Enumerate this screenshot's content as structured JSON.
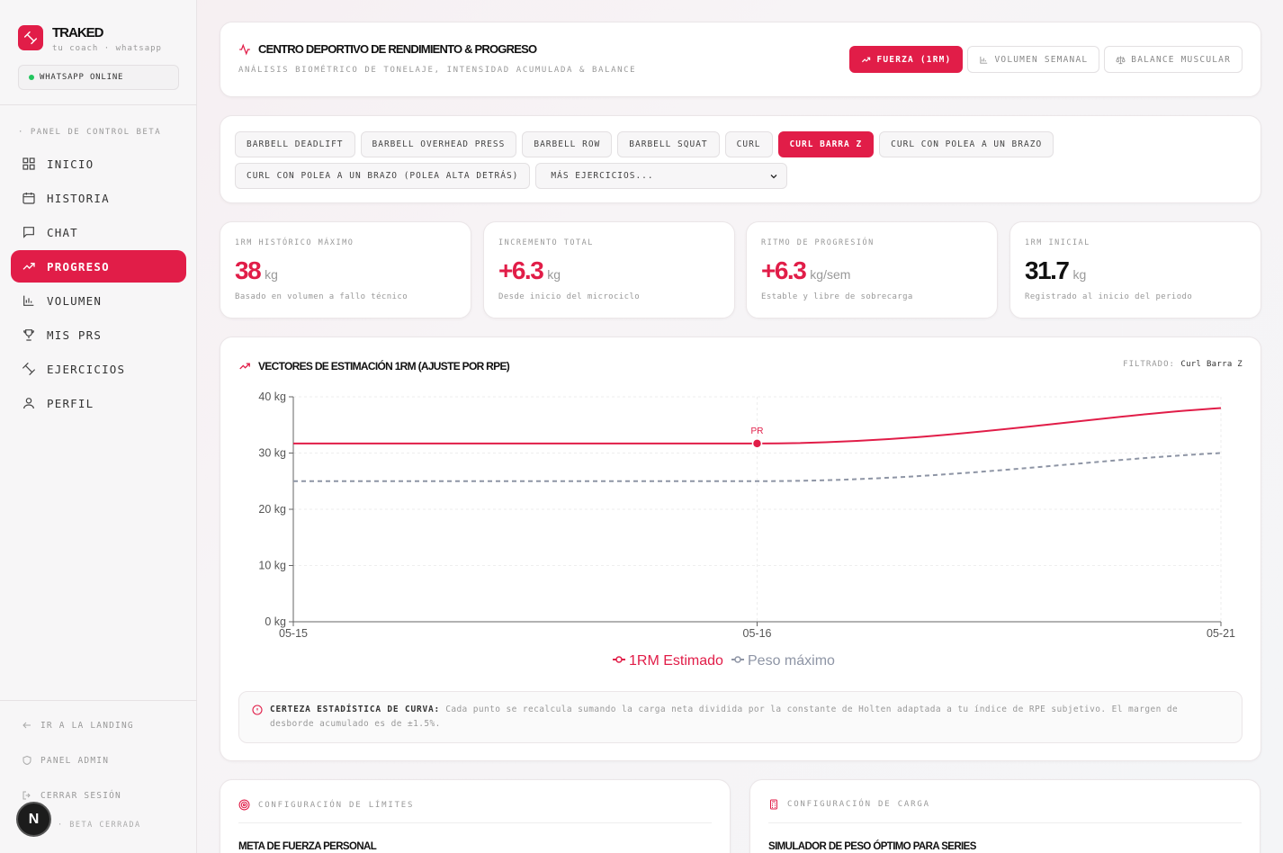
{
  "brand": {
    "name": "TRAKED",
    "subtitle": "tu coach · whatsapp"
  },
  "whatsapp_status": "WHATSAPP ONLINE",
  "sidebar": {
    "section_label": "· PANEL DE CONTROL BETA",
    "items": [
      {
        "label": "INICIO",
        "icon": "grid-icon"
      },
      {
        "label": "HISTORIA",
        "icon": "calendar-icon"
      },
      {
        "label": "CHAT",
        "icon": "chat-icon"
      },
      {
        "label": "PROGRESO",
        "icon": "trending-up-icon",
        "active": true
      },
      {
        "label": "VOLUMEN",
        "icon": "bar-chart-icon"
      },
      {
        "label": "MIS PRS",
        "icon": "trophy-icon"
      },
      {
        "label": "EJERCICIOS",
        "icon": "dumbbell-icon"
      },
      {
        "label": "PERFIL",
        "icon": "user-icon"
      }
    ],
    "footer": {
      "landing": "IR A LA LANDING",
      "admin": "PANEL ADMIN",
      "logout": "CERRAR SESIÓN",
      "beta": "· BETA CERRADA"
    },
    "badge": "N"
  },
  "header": {
    "title": "CENTRO DEPORTIVO DE RENDIMIENTO & PROGRESO",
    "subtitle": "ANÁLISIS BIOMÉTRICO DE TONELAJE, INTENSIDAD ACUMULADA & BALANCE",
    "tabs": [
      {
        "label": "FUERZA (1RM)",
        "active": true
      },
      {
        "label": "VOLUMEN SEMANAL"
      },
      {
        "label": "BALANCE MUSCULAR"
      }
    ]
  },
  "exercises": {
    "row1": [
      "BARBELL DEADLIFT",
      "BARBELL OVERHEAD PRESS",
      "BARBELL ROW",
      "BARBELL SQUAT",
      "CURL",
      "CURL BARRA Z",
      "CURL CON POLEA A UN BRAZO"
    ],
    "active": "CURL BARRA Z",
    "row2": [
      "CURL CON POLEA A UN BRAZO (POLEA ALTA DETRÁS)"
    ],
    "more_select": "MÁS EJERCICIOS..."
  },
  "stats": [
    {
      "label": "1RM HISTÓRICO MÁXIMO",
      "value": "38",
      "unit": "kg",
      "desc": "Basado en volumen a fallo técnico",
      "color": "#e11d48"
    },
    {
      "label": "INCREMENTO TOTAL",
      "value": "+6.3",
      "unit": "kg",
      "desc": "Desde inicio del microciclo",
      "color": "#e11d48"
    },
    {
      "label": "RITMO DE PROGRESIÓN",
      "value": "+6.3",
      "unit": "kg/sem",
      "desc": "Estable y libre de sobrecarga",
      "color": "#e11d48"
    },
    {
      "label": "1RM INICIAL",
      "value": "31.7",
      "unit": "kg",
      "desc": "Registrado al inicio del periodo",
      "color": "#111111"
    }
  ],
  "chart": {
    "title": "VECTORES DE ESTIMACIÓN 1RM (AJUSTE POR RPE)",
    "filter_label": "FILTRADO:",
    "filter_value": "Curl Barra Z",
    "info_title": "CERTEZA ESTADÍSTICA DE CURVA:",
    "info_text": "Cada punto se recalcula sumando la carga neta dividida por la constante de Holten adaptada a tu índice de RPE subjetivo. El margen de desborde acumulado es de ±1.5%."
  },
  "chart_data": {
    "type": "line",
    "x": [
      "05-15",
      "05-16",
      "05-21"
    ],
    "series": [
      {
        "name": "1RM Estimado",
        "values": [
          31.7,
          31.7,
          38
        ],
        "color": "#e11d48",
        "style": "solid"
      },
      {
        "name": "Peso máximo",
        "values": [
          25,
          25,
          30
        ],
        "color": "#8e95a5",
        "style": "dashed"
      }
    ],
    "annotations": [
      {
        "x": "05-16",
        "series": "1RM Estimado",
        "text": "PR"
      }
    ],
    "yticks": [
      "0 kg",
      "10 kg",
      "20 kg",
      "30 kg",
      "40 kg"
    ],
    "ylim": [
      0,
      40
    ],
    "grid": true,
    "legend": "bottom-center"
  },
  "bottom": {
    "left_label": "CONFIGURACIÓN DE LÍMITES",
    "left_title": "META DE FUERZA PERSONAL",
    "right_label": "CONFIGURACIÓN DE CARGA",
    "right_title": "SIMULADOR DE PESO ÓPTIMO PARA SERIES"
  }
}
